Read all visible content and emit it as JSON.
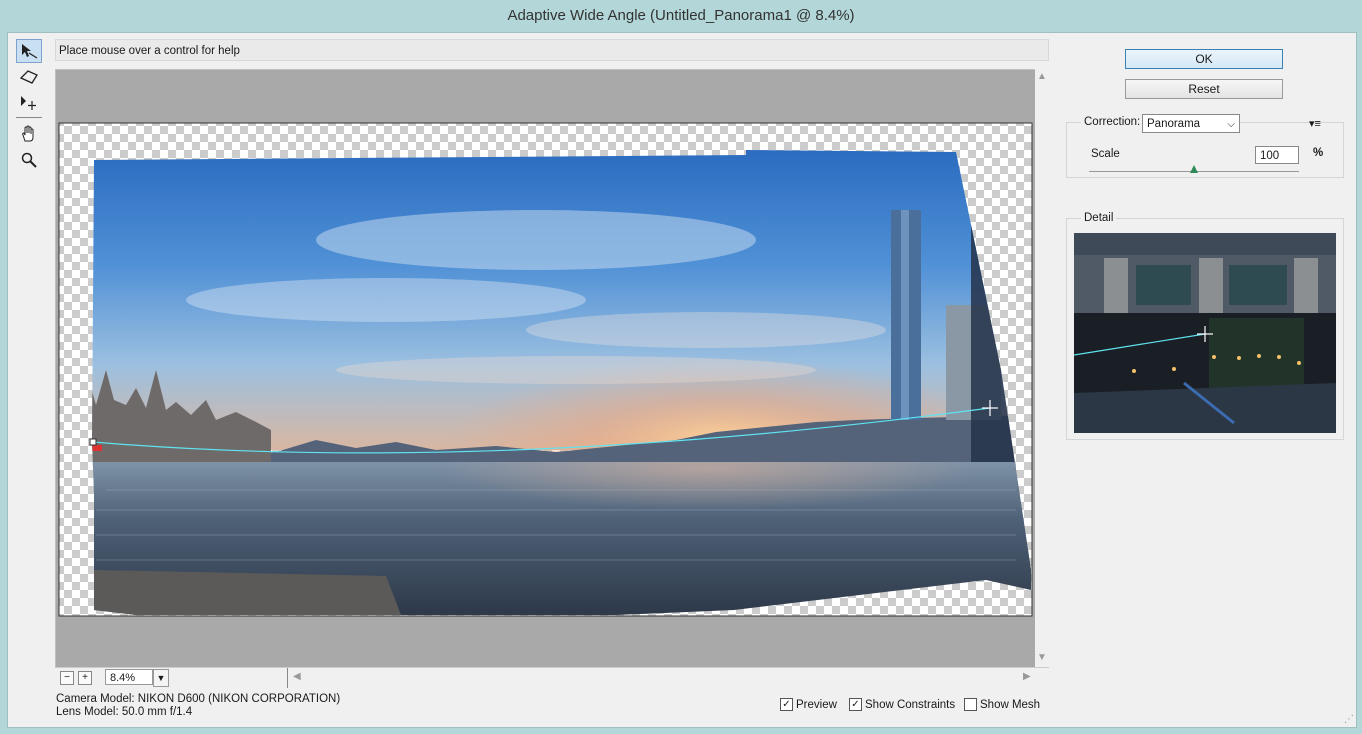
{
  "window": {
    "title": "Adaptive Wide Angle (Untitled_Panorama1 @ 8.4%)"
  },
  "tools": [
    {
      "name": "constraint-tool-icon",
      "active": true
    },
    {
      "name": "polygon-constraint-tool-icon",
      "active": false
    },
    {
      "name": "move-tool-icon",
      "active": false
    },
    {
      "name": "hand-tool-icon",
      "active": false
    },
    {
      "name": "zoom-tool-icon",
      "active": false
    }
  ],
  "help": {
    "text": "Place mouse over a control for help"
  },
  "zoom": {
    "minus": "−",
    "plus": "+",
    "value": "8.4%"
  },
  "camera": {
    "model": "Camera Model: NIKON D600 (NIKON CORPORATION)",
    "lens": "Lens Model: 50.0 mm f/1.4"
  },
  "checks": {
    "preview": {
      "label": "Preview",
      "checked": true
    },
    "constraints": {
      "label": "Show Constraints",
      "checked": true
    },
    "mesh": {
      "label": "Show Mesh",
      "checked": false
    }
  },
  "buttons": {
    "ok": "OK",
    "reset": "Reset"
  },
  "correction": {
    "label": "Correction:",
    "value": "Panorama"
  },
  "scale": {
    "label": "Scale",
    "value": "100",
    "unit": "%",
    "level": 0.5
  },
  "detail": {
    "label": "Detail"
  },
  "colors": {
    "constraint": "#5fe3f0",
    "accent": "#3c7fb1"
  }
}
